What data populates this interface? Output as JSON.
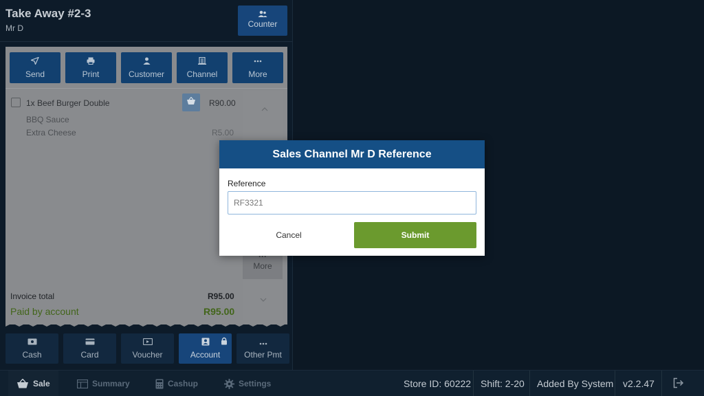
{
  "order": {
    "title": "Take Away #2-3",
    "subtitle": "Mr D",
    "counter_label": "Counter"
  },
  "actions": [
    {
      "label": "Send",
      "icon": "send-icon"
    },
    {
      "label": "Print",
      "icon": "printer-icon"
    },
    {
      "label": "Customer",
      "icon": "user-icon"
    },
    {
      "label": "Channel",
      "icon": "building-icon"
    },
    {
      "label": "More",
      "icon": "more-icon"
    }
  ],
  "items": [
    {
      "name": "1x Beef Burger Double",
      "price": "R90.00"
    }
  ],
  "modifiers": [
    {
      "name": "BBQ Sauce",
      "price": ""
    },
    {
      "name": "Extra Cheese",
      "price": "R5.00"
    }
  ],
  "side": {
    "more_label": "More",
    "more_dots": "···"
  },
  "totals": {
    "invoice_label": "Invoice total",
    "invoice_value": "R95.00",
    "paid_label": "Paid by account",
    "paid_value": "R95.00"
  },
  "payments": [
    {
      "label": "Cash",
      "icon": "cash-icon"
    },
    {
      "label": "Card",
      "icon": "card-icon"
    },
    {
      "label": "Voucher",
      "icon": "voucher-icon"
    },
    {
      "label": "Account",
      "icon": "account-icon",
      "active": true
    },
    {
      "label": "Other Pmt",
      "icon": "more-icon"
    }
  ],
  "nav": [
    {
      "label": "Sale",
      "icon": "basket-icon",
      "active": true
    },
    {
      "label": "Summary",
      "icon": "table-icon"
    },
    {
      "label": "Cashup",
      "icon": "calculator-icon"
    },
    {
      "label": "Settings",
      "icon": "gear-icon"
    }
  ],
  "status": {
    "store": "Store ID: 60222",
    "shift": "Shift: 2-20",
    "added_by": "Added By System",
    "version": "v2.2.47"
  },
  "dialog": {
    "title": "Sales Channel Mr D Reference",
    "field_label": "Reference",
    "field_value": "RF3321",
    "cancel_label": "Cancel",
    "submit_label": "Submit"
  },
  "colors": {
    "primary": "#154f85",
    "submit": "#6b9a2e",
    "paid": "#42651a",
    "background": "#0c1824"
  }
}
